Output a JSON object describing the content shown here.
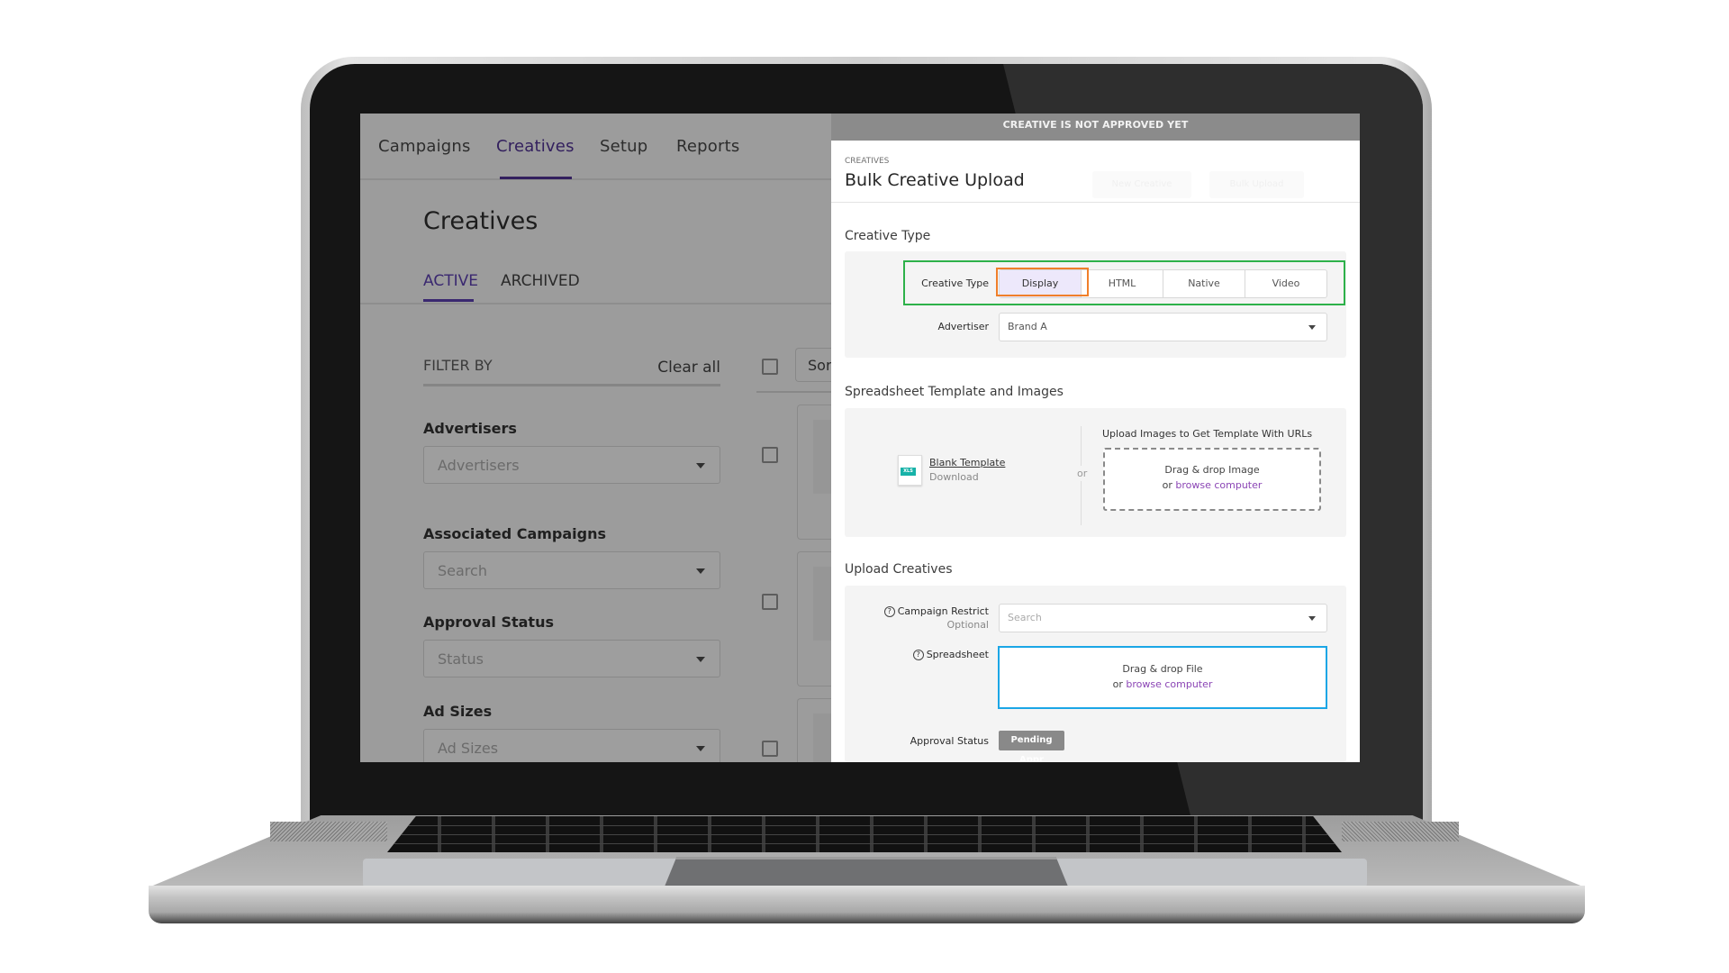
{
  "app": {
    "nav": [
      "Campaigns",
      "Creatives",
      "Setup",
      "Reports"
    ],
    "active_nav": "Creatives",
    "page_title": "Creatives",
    "tabs": [
      "ACTIVE",
      "ARCHIVED"
    ],
    "active_tab": "ACTIVE",
    "filter": {
      "heading": "FILTER BY",
      "clear_all": "Clear all",
      "groups": [
        {
          "label": "Advertisers",
          "placeholder": "Advertisers"
        },
        {
          "label": "Associated Campaigns",
          "placeholder": "Search"
        },
        {
          "label": "Approval Status",
          "placeholder": "Status"
        },
        {
          "label": "Ad Sizes",
          "placeholder": "Ad Sizes"
        }
      ]
    },
    "list": {
      "sort_label": "Sort",
      "chevron_glyph": "‹"
    }
  },
  "modal": {
    "banner": "CREATIVE IS NOT APPROVED YET",
    "breadcrumb": "CREATIVES",
    "title": "Bulk Creative Upload",
    "ghost_buttons": [
      "New Creative",
      "Bulk Upload"
    ],
    "creative_type_section": {
      "title": "Creative Type",
      "type_label": "Creative Type",
      "options": [
        "Display",
        "HTML",
        "Native",
        "Video"
      ],
      "selected": "Display",
      "advertiser_label": "Advertiser",
      "advertiser_value": "Brand A"
    },
    "template_section": {
      "title": "Spreadsheet Template and Images",
      "file_badge": "XLS",
      "blank_template": "Blank Template",
      "download": "Download",
      "or": "or",
      "upload_images_title": "Upload Images to Get Template With URLs",
      "drop_text": "Drag & drop Image",
      "or_prefix": "or",
      "browse": "browse computer"
    },
    "upload_section": {
      "title": "Upload Creatives",
      "help_glyph": "?",
      "campaign_restrict_label": "Campaign Restrict",
      "campaign_restrict_note": "Optional",
      "campaign_restrict_placeholder": "Search",
      "spreadsheet_label": "Spreadsheet",
      "drop_text": "Drag & drop File",
      "or_prefix": "or",
      "browse": "browse computer",
      "approval_label": "Approval Status",
      "approval_value": "Pending Appr"
    }
  },
  "colors": {
    "brand_purple": "#33205e",
    "highlight_green": "#2db14a",
    "highlight_orange": "#f07f2a",
    "dropzone_blue": "#1ba6e6",
    "link_purple": "#8b45b5",
    "xls_teal": "#17b2a8",
    "selected_option_bg": "#ede8fb"
  }
}
